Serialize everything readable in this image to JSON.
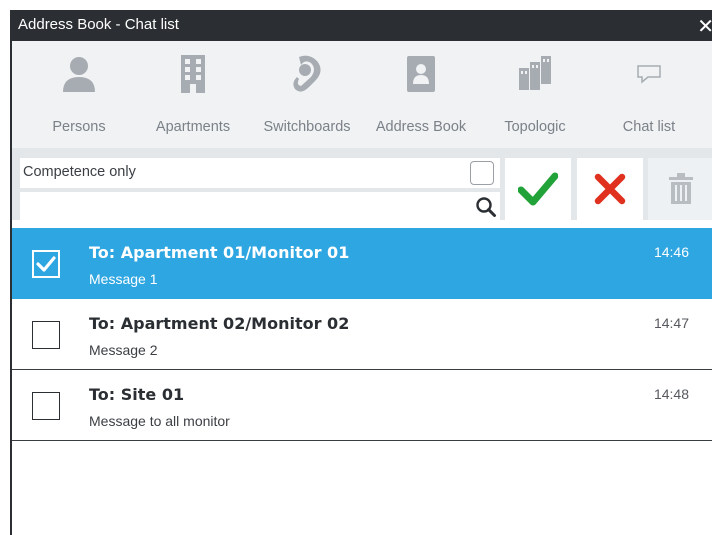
{
  "window": {
    "title": "Address Book - Chat list",
    "close_glyph": "✕"
  },
  "toolbar": {
    "items": [
      {
        "label": "Persons",
        "icon": "person-icon"
      },
      {
        "label": "Apartments",
        "icon": "building-icon"
      },
      {
        "label": "Switchboards",
        "icon": "operator-headset-icon"
      },
      {
        "label": "Address Book",
        "icon": "address-book-icon"
      },
      {
        "label": "Topologic",
        "icon": "topology-buildings-icon"
      },
      {
        "label": "Chat list",
        "icon": "chat-bubble-icon"
      }
    ]
  },
  "filter": {
    "competence_label": "Competence only",
    "competence_checked": false,
    "search_value": "",
    "search_placeholder": ""
  },
  "actions": {
    "confirm_icon": "checkmark-icon",
    "cancel_icon": "x-icon",
    "delete_icon": "trash-icon"
  },
  "chats": [
    {
      "to": "To: Apartment 01/Monitor 01",
      "message": "Message 1",
      "time": "14:46",
      "selected": true
    },
    {
      "to": "To: Apartment 02/Monitor 02",
      "message": "Message 2",
      "time": "14:47",
      "selected": false
    },
    {
      "to": "To: Site 01",
      "message": "Message to all monitor",
      "time": "14:48",
      "selected": false
    }
  ],
  "colors": {
    "titlebar": "#2b2f33",
    "selected_row": "#2ea6e1",
    "confirm": "#22a33a",
    "cancel": "#e0301e",
    "icon_gray": "#a6acb2"
  }
}
